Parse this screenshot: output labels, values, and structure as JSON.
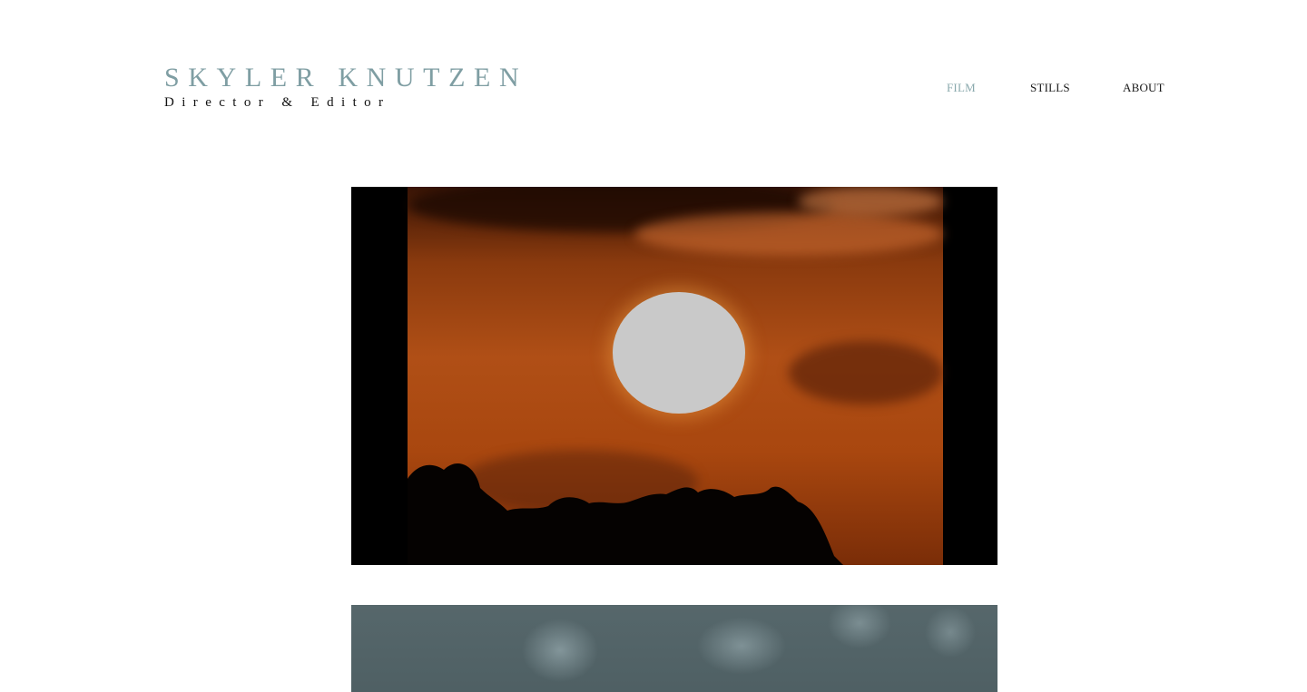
{
  "brand": {
    "name": "SKYLER KNUTZEN",
    "subtitle": "Director & Editor"
  },
  "nav": {
    "items": [
      {
        "label": "FILM",
        "active": true
      },
      {
        "label": "STILLS",
        "active": false
      },
      {
        "label": "ABOUT",
        "active": false
      }
    ]
  },
  "main": {
    "videos": [
      {
        "thumbnail": "orange sunset with silhouetted trees"
      },
      {
        "thumbnail": "grey-blue textured footage"
      }
    ]
  },
  "colors": {
    "brand": "#7f9ea3",
    "nav_active": "#8aa9ad",
    "text": "#111111",
    "background": "#ffffff"
  }
}
